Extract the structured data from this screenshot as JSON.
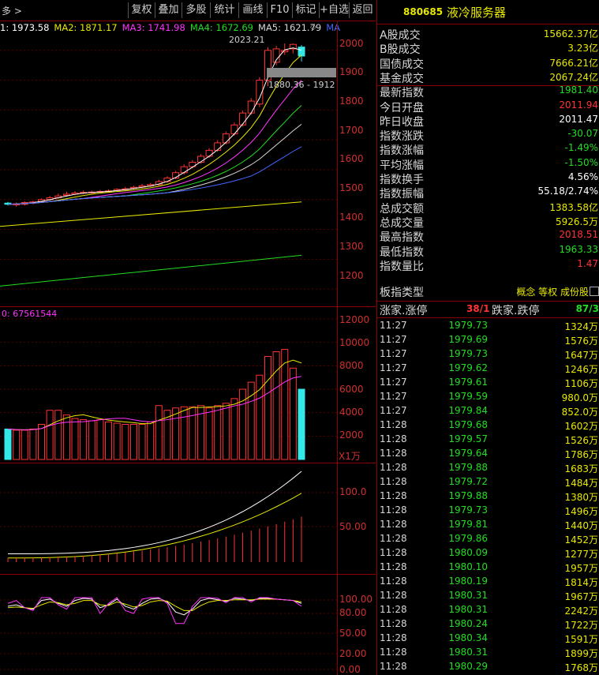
{
  "toolbar": {
    "left_label": "多 >",
    "buttons": [
      "复权",
      "叠加",
      "多股",
      "统计",
      "画线",
      "F10",
      "标记",
      "+自选",
      "返回"
    ]
  },
  "ma_legend": [
    {
      "label": "1: 1973.58",
      "color": "#ffffff"
    },
    {
      "label": "MA2: 1871.17",
      "color": "#e8e800"
    },
    {
      "label": "MA3: 1741.98",
      "color": "#ff33ff"
    },
    {
      "label": "MA4: 1672.69",
      "color": "#22dd22"
    },
    {
      "label": "MA5: 1621.79",
      "color": "#d8d8d8"
    },
    {
      "label": "MA",
      "color": "#4466ff"
    }
  ],
  "price_axis": [
    "2000",
    "1900",
    "1800",
    "1700",
    "1600",
    "1500",
    "1400",
    "1300",
    "1200"
  ],
  "annotations": {
    "high": "2023.21",
    "low": "1880.36 - 1912"
  },
  "volume_label": "0: 67561544",
  "volume_axis": [
    "12000",
    "10000",
    "8000",
    "6000",
    "4000",
    "2000"
  ],
  "volume_unit": "X1万",
  "ind1_axis": [
    "100.0",
    "50.00"
  ],
  "ind2_axis": [
    "100.00",
    "80.00",
    "50.00",
    "20.00",
    "0.00"
  ],
  "panel": {
    "code": "880685",
    "name": "液冷服务器",
    "rows": [
      {
        "label": "A股成交",
        "value": "15662.37亿",
        "color": "#e8e800"
      },
      {
        "label": "B股成交",
        "value": "3.23亿",
        "color": "#e8e800"
      },
      {
        "label": "国债成交",
        "value": "7666.21亿",
        "color": "#e8e800"
      },
      {
        "label": "基金成交",
        "value": "2067.24亿",
        "color": "#e8e800"
      },
      {
        "label": "最新指数",
        "value": "1981.40",
        "color": "#22dd22"
      },
      {
        "label": "今日开盘",
        "value": "2011.94",
        "color": "#ff3333"
      },
      {
        "label": "昨日收盘",
        "value": "2011.47",
        "color": "#ffffff"
      },
      {
        "label": "指数涨跌",
        "value": "-30.07",
        "color": "#22dd22"
      },
      {
        "label": "指数涨幅",
        "value": "-1.49%",
        "color": "#22dd22"
      },
      {
        "label": "平均涨幅",
        "value": "-1.50%",
        "color": "#22dd22"
      },
      {
        "label": "指数换手",
        "value": "4.56%",
        "color": "#ffffff"
      },
      {
        "label": "指数振幅",
        "value": "55.18/2.74%",
        "color": "#ffffff"
      },
      {
        "label": "总成交额",
        "value": "1383.58亿",
        "color": "#e8e800"
      },
      {
        "label": "总成交量",
        "value": "5926.5万",
        "color": "#e8e800"
      },
      {
        "label": "最高指数",
        "value": "2018.51",
        "color": "#ff3333"
      },
      {
        "label": "最低指数",
        "value": "1963.33",
        "color": "#22dd22"
      },
      {
        "label": "指数量比",
        "value": "1.47",
        "color": "#ff3333"
      }
    ],
    "sector_type_label": "板指类型",
    "sector_tags": "概念 等权 成份股",
    "rise_label": "涨家.涨停",
    "rise_value": "38/1",
    "fall_label": "跌家.跌停",
    "fall_value": "87/3",
    "ticks": [
      {
        "time": "11:27",
        "price": "1979.73",
        "vol": "1324万"
      },
      {
        "time": "11:27",
        "price": "1979.69",
        "vol": "1576万"
      },
      {
        "time": "11:27",
        "price": "1979.73",
        "vol": "1647万"
      },
      {
        "time": "11:27",
        "price": "1979.62",
        "vol": "1246万"
      },
      {
        "time": "11:27",
        "price": "1979.61",
        "vol": "1106万"
      },
      {
        "time": "11:27",
        "price": "1979.59",
        "vol": "980.0万"
      },
      {
        "time": "11:27",
        "price": "1979.84",
        "vol": "852.0万"
      },
      {
        "time": "11:28",
        "price": "1979.68",
        "vol": "1602万"
      },
      {
        "time": "11:28",
        "price": "1979.57",
        "vol": "1526万"
      },
      {
        "time": "11:28",
        "price": "1979.64",
        "vol": "1786万"
      },
      {
        "time": "11:28",
        "price": "1979.88",
        "vol": "1683万"
      },
      {
        "time": "11:28",
        "price": "1979.72",
        "vol": "1484万"
      },
      {
        "time": "11:28",
        "price": "1979.88",
        "vol": "1380万"
      },
      {
        "time": "11:28",
        "price": "1979.73",
        "vol": "1496万"
      },
      {
        "time": "11:28",
        "price": "1979.81",
        "vol": "1440万"
      },
      {
        "time": "11:28",
        "price": "1979.86",
        "vol": "1452万"
      },
      {
        "time": "11:28",
        "price": "1980.09",
        "vol": "1277万"
      },
      {
        "time": "11:28",
        "price": "1980.10",
        "vol": "1957万"
      },
      {
        "time": "11:28",
        "price": "1980.19",
        "vol": "1814万"
      },
      {
        "time": "11:28",
        "price": "1980.31",
        "vol": "1967万"
      },
      {
        "time": "11:28",
        "price": "1980.31",
        "vol": "2242万"
      },
      {
        "time": "11:28",
        "price": "1980.24",
        "vol": "1722万"
      },
      {
        "time": "11:28",
        "price": "1980.34",
        "vol": "1591万"
      },
      {
        "time": "11:28",
        "price": "1980.31",
        "vol": "1899万"
      },
      {
        "time": "11:28",
        "price": "1980.29",
        "vol": "1768万"
      }
    ]
  },
  "chart_data": {
    "type": "candlestick",
    "candles": [
      [
        1488,
        1484,
        1492,
        1480
      ],
      [
        1482,
        1486,
        1490,
        1476
      ],
      [
        1484,
        1490,
        1494,
        1480
      ],
      [
        1488,
        1492,
        1496,
        1484
      ],
      [
        1494,
        1500,
        1504,
        1490
      ],
      [
        1500,
        1506,
        1512,
        1496
      ],
      [
        1506,
        1512,
        1520,
        1502
      ],
      [
        1514,
        1518,
        1526,
        1510
      ],
      [
        1518,
        1522,
        1528,
        1514
      ],
      [
        1522,
        1524,
        1530,
        1518
      ],
      [
        1524,
        1525,
        1530,
        1520
      ],
      [
        1525,
        1527,
        1532,
        1521
      ],
      [
        1527,
        1529,
        1534,
        1523
      ],
      [
        1530,
        1534,
        1538,
        1526
      ],
      [
        1534,
        1536,
        1542,
        1530
      ],
      [
        1538,
        1541,
        1546,
        1534
      ],
      [
        1542,
        1546,
        1552,
        1538
      ],
      [
        1546,
        1550,
        1556,
        1542
      ],
      [
        1550,
        1560,
        1566,
        1546
      ],
      [
        1560,
        1572,
        1578,
        1556
      ],
      [
        1572,
        1590,
        1596,
        1568
      ],
      [
        1590,
        1610,
        1618,
        1584
      ],
      [
        1610,
        1625,
        1632,
        1604
      ],
      [
        1625,
        1645,
        1652,
        1620
      ],
      [
        1645,
        1665,
        1672,
        1640
      ],
      [
        1665,
        1690,
        1698,
        1660
      ],
      [
        1690,
        1720,
        1728,
        1685
      ],
      [
        1720,
        1750,
        1758,
        1714
      ],
      [
        1750,
        1790,
        1798,
        1744
      ],
      [
        1790,
        1830,
        1840,
        1784
      ],
      [
        1820,
        1900,
        1910,
        1810
      ],
      [
        1900,
        2000,
        2010,
        1880
      ],
      [
        1960,
        2005,
        2015,
        1950
      ],
      [
        1995,
        2000,
        2023,
        1985
      ],
      [
        2005,
        2020,
        2023,
        1990
      ],
      [
        2011,
        1981,
        2018,
        1963
      ]
    ],
    "volume": [
      2600,
      2500,
      2500,
      2600,
      3000,
      4200,
      4200,
      3800,
      3500,
      3400,
      3300,
      3400,
      3200,
      3100,
      3000,
      3000,
      3000,
      3200,
      4600,
      4200,
      4400,
      4500,
      4500,
      4600,
      4400,
      4600,
      4800,
      5200,
      6000,
      6600,
      7200,
      8800,
      9200,
      9400,
      7800,
      6000
    ],
    "price_ylim": [
      1150,
      2100
    ],
    "volume_ylim": [
      0,
      12000
    ]
  }
}
